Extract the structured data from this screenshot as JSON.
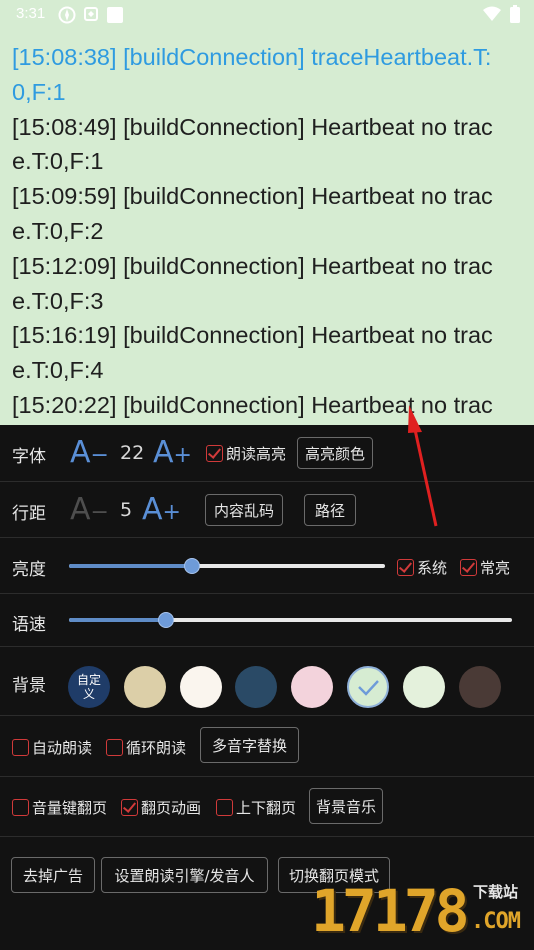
{
  "status_bar": {
    "time": "3:31"
  },
  "reader": {
    "lines": [
      {
        "text": "[15:08:38] [buildConnection] traceHeartbeat.T:",
        "highlight": true
      },
      {
        "text": "0,F:1",
        "highlight": true
      },
      {
        "text": "[15:08:49] [buildConnection] Heartbeat no trac",
        "highlight": false
      },
      {
        "text": "e.T:0,F:1",
        "highlight": false
      },
      {
        "text": "[15:09:59] [buildConnection] Heartbeat no trac",
        "highlight": false
      },
      {
        "text": "e.T:0,F:2",
        "highlight": false
      },
      {
        "text": "[15:12:09] [buildConnection] Heartbeat no trac",
        "highlight": false
      },
      {
        "text": "e.T:0,F:3",
        "highlight": false
      },
      {
        "text": "[15:16:19] [buildConnection] Heartbeat no trac",
        "highlight": false
      },
      {
        "text": "e.T:0,F:4",
        "highlight": false
      },
      {
        "text": "[15:20:22] [buildConnection] Heartbeat no trac",
        "highlight": false
      }
    ],
    "background_color": "#d6ecd2",
    "highlight_color": "#2f9be0"
  },
  "font_row": {
    "label": "字体",
    "decrease": "A",
    "decrease_sign": "−",
    "size": "22",
    "increase": "A",
    "increase_sign": "+",
    "read_highlight": {
      "label": "朗读高亮",
      "checked": true
    },
    "highlight_color_button": "高亮颜色"
  },
  "spacing_row": {
    "label": "行距",
    "decrease": "A",
    "decrease_sign": "−",
    "value": "5",
    "increase": "A",
    "increase_sign": "+",
    "garbled_button": "内容乱码",
    "path_button": "路径"
  },
  "brightness_row": {
    "label": "亮度",
    "level": 0.39,
    "system": {
      "label": "系统",
      "checked": true
    },
    "always_on": {
      "label": "常亮",
      "checked": true
    }
  },
  "speed_row": {
    "label": "语速",
    "level": 0.22
  },
  "background_row": {
    "label": "背景",
    "custom_label": "自定义",
    "swatches": [
      "#1f3c68",
      "#dccfa8",
      "#faf5ee",
      "#2a4a66",
      "#f3d3dc",
      "#d6ecd2",
      "#e4f1dc",
      "#4a3a36"
    ],
    "selected_index": 5
  },
  "auto_row": {
    "auto_read": {
      "label": "自动朗读",
      "checked": false
    },
    "loop_read": {
      "label": "循环朗读",
      "checked": false
    },
    "polyphone_button": "多音字替换"
  },
  "page_row": {
    "volume_key": {
      "label": "音量键翻页",
      "checked": false
    },
    "page_anim": {
      "label": "翻页动画",
      "checked": true
    },
    "vertical": {
      "label": "上下翻页",
      "checked": false
    },
    "music_button": "背景音乐"
  },
  "bottom_row": {
    "remove_ads": "去掉广告",
    "tts_engine": "设置朗读引擎/发音人",
    "switch_mode": "切换翻页模式"
  },
  "watermark": {
    "number": "17178",
    "label": "下载站",
    "suffix": ".COM"
  },
  "colors": {
    "accent": "#5a8fd6",
    "checkbox": "#d03a3a",
    "panel": "#121212"
  }
}
